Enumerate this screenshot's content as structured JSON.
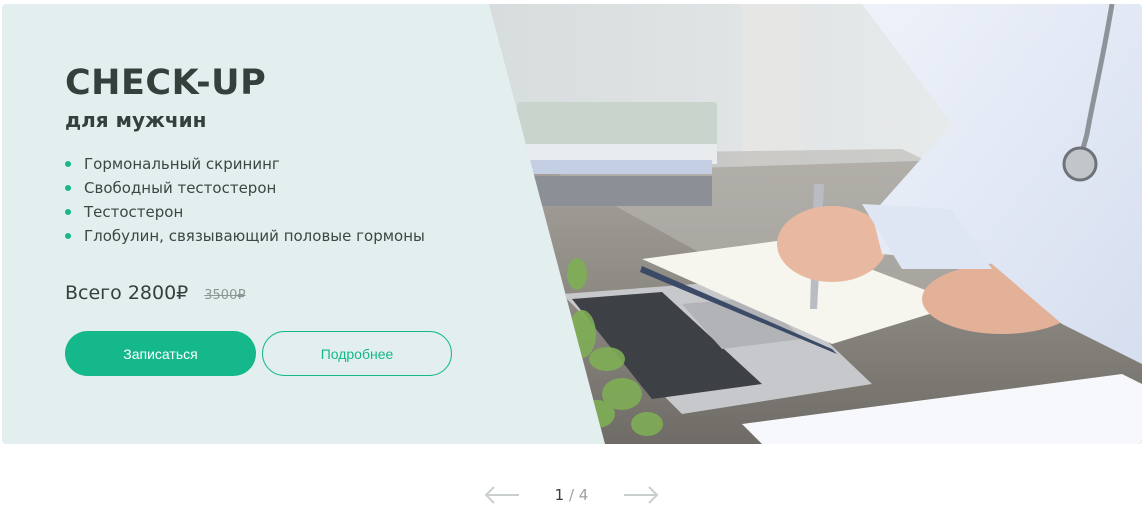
{
  "banner": {
    "title": "CHECK-UP",
    "subtitle": "для мужчин",
    "features": [
      "Гормональный скрининг",
      "Свободный тестостерон",
      "Тестостерон",
      "Глобулин, связывающий половые гормоны"
    ],
    "price": "Всего 2800₽",
    "old_price": "3500₽",
    "primary_button": "Записаться",
    "secondary_button": "Подробнее",
    "accent_color": "#14b88a",
    "background_color": "#e2efee"
  },
  "pager": {
    "current": "1",
    "separator": " / ",
    "total": "4",
    "prev_icon": "arrow-left-icon",
    "next_icon": "arrow-right-icon"
  }
}
